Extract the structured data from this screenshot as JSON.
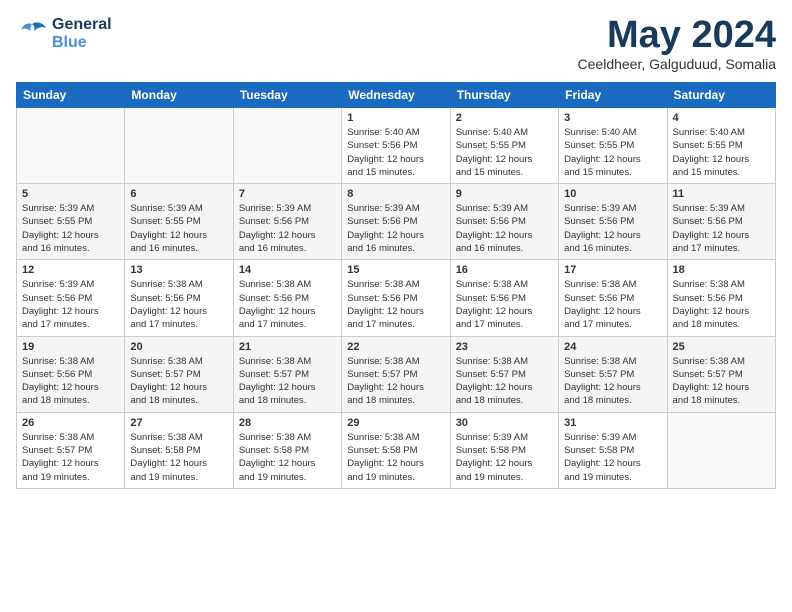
{
  "header": {
    "logo_line1": "General",
    "logo_line2": "Blue",
    "month_title": "May 2024",
    "location": "Ceeldheer, Galguduud, Somalia"
  },
  "days_of_week": [
    "Sunday",
    "Monday",
    "Tuesday",
    "Wednesday",
    "Thursday",
    "Friday",
    "Saturday"
  ],
  "weeks": [
    [
      {
        "day": "",
        "info": ""
      },
      {
        "day": "",
        "info": ""
      },
      {
        "day": "",
        "info": ""
      },
      {
        "day": "1",
        "info": "Sunrise: 5:40 AM\nSunset: 5:56 PM\nDaylight: 12 hours\nand 15 minutes."
      },
      {
        "day": "2",
        "info": "Sunrise: 5:40 AM\nSunset: 5:55 PM\nDaylight: 12 hours\nand 15 minutes."
      },
      {
        "day": "3",
        "info": "Sunrise: 5:40 AM\nSunset: 5:55 PM\nDaylight: 12 hours\nand 15 minutes."
      },
      {
        "day": "4",
        "info": "Sunrise: 5:40 AM\nSunset: 5:55 PM\nDaylight: 12 hours\nand 15 minutes."
      }
    ],
    [
      {
        "day": "5",
        "info": "Sunrise: 5:39 AM\nSunset: 5:55 PM\nDaylight: 12 hours\nand 16 minutes."
      },
      {
        "day": "6",
        "info": "Sunrise: 5:39 AM\nSunset: 5:55 PM\nDaylight: 12 hours\nand 16 minutes."
      },
      {
        "day": "7",
        "info": "Sunrise: 5:39 AM\nSunset: 5:56 PM\nDaylight: 12 hours\nand 16 minutes."
      },
      {
        "day": "8",
        "info": "Sunrise: 5:39 AM\nSunset: 5:56 PM\nDaylight: 12 hours\nand 16 minutes."
      },
      {
        "day": "9",
        "info": "Sunrise: 5:39 AM\nSunset: 5:56 PM\nDaylight: 12 hours\nand 16 minutes."
      },
      {
        "day": "10",
        "info": "Sunrise: 5:39 AM\nSunset: 5:56 PM\nDaylight: 12 hours\nand 16 minutes."
      },
      {
        "day": "11",
        "info": "Sunrise: 5:39 AM\nSunset: 5:56 PM\nDaylight: 12 hours\nand 17 minutes."
      }
    ],
    [
      {
        "day": "12",
        "info": "Sunrise: 5:39 AM\nSunset: 5:56 PM\nDaylight: 12 hours\nand 17 minutes."
      },
      {
        "day": "13",
        "info": "Sunrise: 5:38 AM\nSunset: 5:56 PM\nDaylight: 12 hours\nand 17 minutes."
      },
      {
        "day": "14",
        "info": "Sunrise: 5:38 AM\nSunset: 5:56 PM\nDaylight: 12 hours\nand 17 minutes."
      },
      {
        "day": "15",
        "info": "Sunrise: 5:38 AM\nSunset: 5:56 PM\nDaylight: 12 hours\nand 17 minutes."
      },
      {
        "day": "16",
        "info": "Sunrise: 5:38 AM\nSunset: 5:56 PM\nDaylight: 12 hours\nand 17 minutes."
      },
      {
        "day": "17",
        "info": "Sunrise: 5:38 AM\nSunset: 5:56 PM\nDaylight: 12 hours\nand 17 minutes."
      },
      {
        "day": "18",
        "info": "Sunrise: 5:38 AM\nSunset: 5:56 PM\nDaylight: 12 hours\nand 18 minutes."
      }
    ],
    [
      {
        "day": "19",
        "info": "Sunrise: 5:38 AM\nSunset: 5:56 PM\nDaylight: 12 hours\nand 18 minutes."
      },
      {
        "day": "20",
        "info": "Sunrise: 5:38 AM\nSunset: 5:57 PM\nDaylight: 12 hours\nand 18 minutes."
      },
      {
        "day": "21",
        "info": "Sunrise: 5:38 AM\nSunset: 5:57 PM\nDaylight: 12 hours\nand 18 minutes."
      },
      {
        "day": "22",
        "info": "Sunrise: 5:38 AM\nSunset: 5:57 PM\nDaylight: 12 hours\nand 18 minutes."
      },
      {
        "day": "23",
        "info": "Sunrise: 5:38 AM\nSunset: 5:57 PM\nDaylight: 12 hours\nand 18 minutes."
      },
      {
        "day": "24",
        "info": "Sunrise: 5:38 AM\nSunset: 5:57 PM\nDaylight: 12 hours\nand 18 minutes."
      },
      {
        "day": "25",
        "info": "Sunrise: 5:38 AM\nSunset: 5:57 PM\nDaylight: 12 hours\nand 18 minutes."
      }
    ],
    [
      {
        "day": "26",
        "info": "Sunrise: 5:38 AM\nSunset: 5:57 PM\nDaylight: 12 hours\nand 19 minutes."
      },
      {
        "day": "27",
        "info": "Sunrise: 5:38 AM\nSunset: 5:58 PM\nDaylight: 12 hours\nand 19 minutes."
      },
      {
        "day": "28",
        "info": "Sunrise: 5:38 AM\nSunset: 5:58 PM\nDaylight: 12 hours\nand 19 minutes."
      },
      {
        "day": "29",
        "info": "Sunrise: 5:38 AM\nSunset: 5:58 PM\nDaylight: 12 hours\nand 19 minutes."
      },
      {
        "day": "30",
        "info": "Sunrise: 5:39 AM\nSunset: 5:58 PM\nDaylight: 12 hours\nand 19 minutes."
      },
      {
        "day": "31",
        "info": "Sunrise: 5:39 AM\nSunset: 5:58 PM\nDaylight: 12 hours\nand 19 minutes."
      },
      {
        "day": "",
        "info": ""
      }
    ]
  ]
}
